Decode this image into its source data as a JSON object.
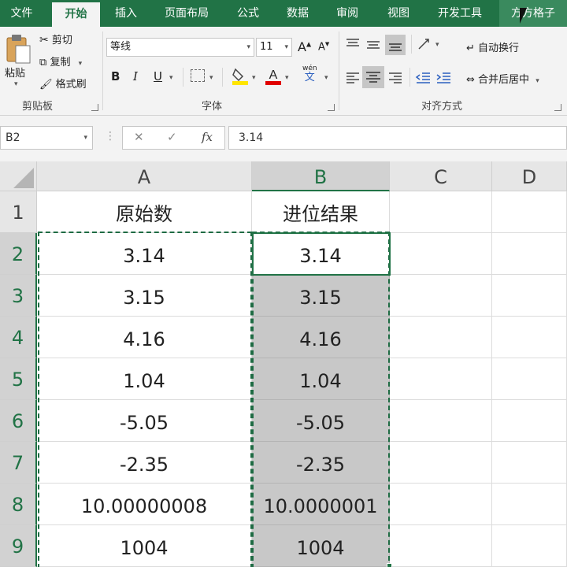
{
  "tabs": [
    "文件",
    "开始",
    "插入",
    "页面布局",
    "公式",
    "数据",
    "审阅",
    "视图",
    "开发工具",
    "方方格子"
  ],
  "active_tab": "开始",
  "ribbon": {
    "clipboard": {
      "paste": "粘贴",
      "cut": "剪切",
      "copy": "复制",
      "format_painter": "格式刷",
      "label": "剪贴板"
    },
    "font": {
      "name": "等线",
      "size": "11",
      "bold": "B",
      "italic": "I",
      "underline": "U",
      "grow": "A",
      "shrink": "A",
      "phonetic_top": "wén",
      "phonetic_bottom": "文",
      "label": "字体"
    },
    "alignment": {
      "wrap": "自动换行",
      "merge": "合并后居中",
      "label": "对齐方式"
    }
  },
  "formula_bar": {
    "name_box": "B2",
    "cancel": "✕",
    "enter": "✓",
    "fx": "fx",
    "value": "3.14"
  },
  "sheet": {
    "columns": [
      "A",
      "B",
      "C",
      "D"
    ],
    "rows": [
      "1",
      "2",
      "3",
      "4",
      "5",
      "6",
      "7",
      "8",
      "9"
    ],
    "headers": {
      "a": "原始数",
      "b": "进位结果"
    },
    "col_a": [
      "3.14",
      "3.15",
      "4.16",
      "1.04",
      "-5.05",
      "-2.35",
      "10.00000008",
      "1004"
    ],
    "col_b": [
      "3.14",
      "3.15",
      "4.16",
      "1.04",
      "-5.05",
      "-2.35",
      "10.0000001",
      "1004"
    ]
  },
  "colors": {
    "accent": "#217346",
    "selection_fill": "#c8c8c8"
  }
}
